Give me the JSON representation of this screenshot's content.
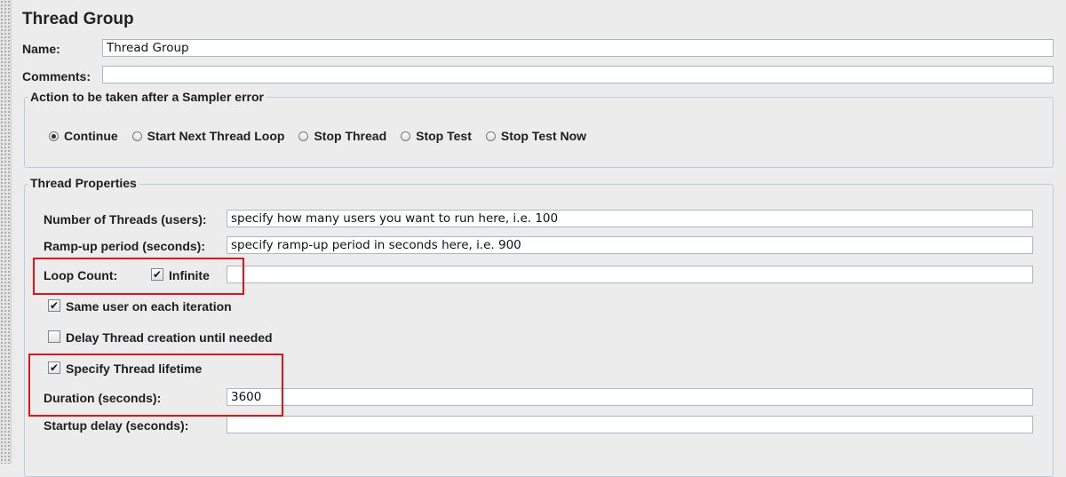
{
  "panel": {
    "title": "Thread Group"
  },
  "name_row": {
    "label": "Name:",
    "value": "Thread Group"
  },
  "comments_row": {
    "label": "Comments:",
    "value": ""
  },
  "sampler_error": {
    "legend": "Action to be taken after a Sampler error",
    "options": [
      {
        "label": "Continue",
        "selected": true
      },
      {
        "label": "Start Next Thread Loop",
        "selected": false
      },
      {
        "label": "Stop Thread",
        "selected": false
      },
      {
        "label": "Stop Test",
        "selected": false
      },
      {
        "label": "Stop Test Now",
        "selected": false
      }
    ]
  },
  "thread_props": {
    "legend": "Thread Properties",
    "num_threads": {
      "label": "Number of Threads (users):",
      "value": "specify how many users you want to run here, i.e. 100"
    },
    "ramp_up": {
      "label": "Ramp-up period (seconds):",
      "value": "specify ramp-up period in seconds here, i.e. 900"
    },
    "loop_count": {
      "label": "Loop Count:",
      "infinite_label": "Infinite",
      "infinite_checked": true,
      "value": ""
    },
    "same_user": {
      "label": "Same user on each iteration",
      "checked": true
    },
    "delay_creation": {
      "label": "Delay Thread creation until needed",
      "checked": false
    },
    "specify_lifetime": {
      "label": "Specify Thread lifetime",
      "checked": true
    },
    "duration": {
      "label": "Duration (seconds):",
      "value": "3600"
    },
    "startup_delay": {
      "label": "Startup delay (seconds):",
      "value": ""
    }
  },
  "icons": {
    "check": "✔"
  },
  "colors": {
    "highlight": "#e0141b",
    "group_border": "#b9cfe0"
  }
}
